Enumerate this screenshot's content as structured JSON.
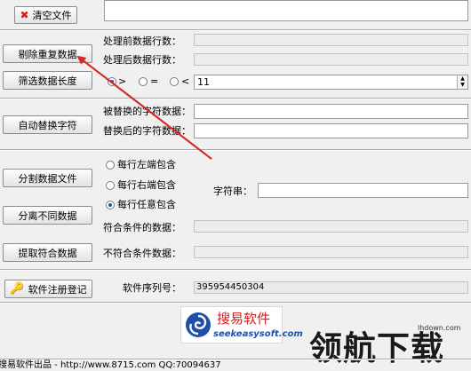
{
  "top": {
    "clear_button": "清空文件"
  },
  "row_counts": {
    "dedupe_button": "剔除重复数据",
    "before_label": "处理前数据行数：",
    "after_label": "处理后数据行数："
  },
  "length_filter": {
    "button": "筛选数据长度",
    "options": [
      ">",
      "=",
      "<"
    ],
    "selected": ">",
    "value": "11"
  },
  "replace": {
    "button": "自动替换字符",
    "from_label": "被替换的字符数据：",
    "to_label": "替换后的字符数据："
  },
  "split": {
    "split_button": "分割数据文件",
    "separate_button": "分离不同数据",
    "extract_button": "提取符合数据",
    "options": [
      "每行左端包含",
      "每行右端包含",
      "每行任意包含"
    ],
    "selected": "每行任意包含",
    "string_label": "字符串：",
    "match_label": "符合条件的数据：",
    "nonmatch_label": "不符合条件数据："
  },
  "register": {
    "button": "软件注册登记",
    "serial_label": "软件序列号：",
    "serial_value": "395954450304"
  },
  "branding": {
    "logo_text": "搜易软件",
    "logo_url": "seekeasysoft.com",
    "watermark_small": "lhdown.com",
    "watermark_big": "领航下载",
    "footer": "搜易软件出品 - http://www.8715.com QQ:70094637"
  },
  "colors": {
    "arrow": "#d42a2a",
    "radio_dot": "#1a4fc7",
    "logo_blue": "#1f4fa8",
    "logo_red": "#d21f1f"
  }
}
